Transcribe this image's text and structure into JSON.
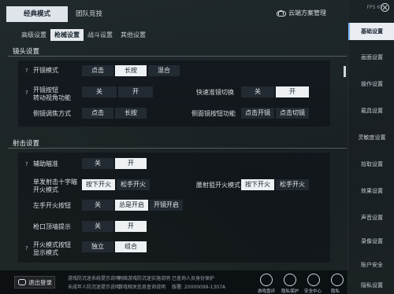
{
  "top_tabs": {
    "classic": "经典模式",
    "team": "团队竞技"
  },
  "cloud": {
    "label": "云端方案管理",
    "icon": "cloud-icon"
  },
  "sub_tabs": [
    "高级设置",
    "枪械设置",
    "战斗设置",
    "其他设置"
  ],
  "scope": {
    "title": "镜头设置",
    "open_scope_mode": {
      "label": "开镜模式",
      "options": [
        "点击",
        "长按",
        "混合"
      ],
      "selected": 1
    },
    "turn_view": {
      "label": "开镜按钮\n转动视角功能",
      "options": [
        "关",
        "开"
      ],
      "selected": 0
    },
    "quick_scope_switch": {
      "label": "快速准镜切换",
      "options": [
        "关",
        "开"
      ],
      "selected": 1
    },
    "tilt_focus": {
      "label": "侧镜调焦方式",
      "options": [
        "点击",
        "长按"
      ],
      "selected": 1
    },
    "side_scope_btn": {
      "label": "侧面镜按钮功能",
      "options": [
        "点击开镜",
        "点击切镜"
      ],
      "selected": 1
    }
  },
  "fire": {
    "title": "射击设置",
    "assist_aim": {
      "label": "辅助瞄准",
      "options": [
        "关",
        "开"
      ],
      "selected": 1
    },
    "single_crosshair": {
      "label": "单发射击十字瞄\n开火模式",
      "options": [
        "按下开火",
        "松手开火"
      ],
      "selected": 0
    },
    "sniper_fire": {
      "label": "腰射狙开火模式",
      "options": [
        "按下开火",
        "松手开火"
      ],
      "selected": 0
    },
    "left_fire": {
      "label": "左手开火按钮",
      "options": [
        "关",
        "总是开启",
        "开镜开启"
      ],
      "selected": 1
    },
    "muzzle_tip": {
      "label": "枪口顶墙提示",
      "options": [
        "关",
        "开"
      ],
      "selected": 1
    },
    "fire_mode_btn": {
      "label": "开火模式按钮\n显示模式",
      "options": [
        "独立",
        "组合"
      ],
      "selected": 1
    }
  },
  "bottom": {
    "exit_label": "退出登录",
    "footer_lines": [
      "游戏防沉迷系统提示说明",
      "未成年人防沉迷提示说明",
      "游戏相关信息查询说明",
      "网络游戏防沉迷实施说明",
      "已查询人员身份保护",
      "国家游戏产业备案",
      "版署: 20000099-1307A",
      "粤网文-20000099"
    ],
    "icons": [
      {
        "name": "lock-icon",
        "label": "游戏盘评"
      },
      {
        "name": "phone-icon",
        "label": "隐私保护"
      },
      {
        "name": "shield-icon",
        "label": "安全中心"
      },
      {
        "name": "user-icon",
        "label": "隐私"
      }
    ]
  },
  "sidebar": {
    "version": "FPS 67",
    "items": [
      "基础设置",
      "画面设置",
      "操作设置",
      "载具设置",
      "灵敏度设置",
      "拾取设置",
      "效果设置",
      "声音设置",
      "录像设置",
      "账户安全",
      "隐私设置"
    ],
    "active": 0
  }
}
